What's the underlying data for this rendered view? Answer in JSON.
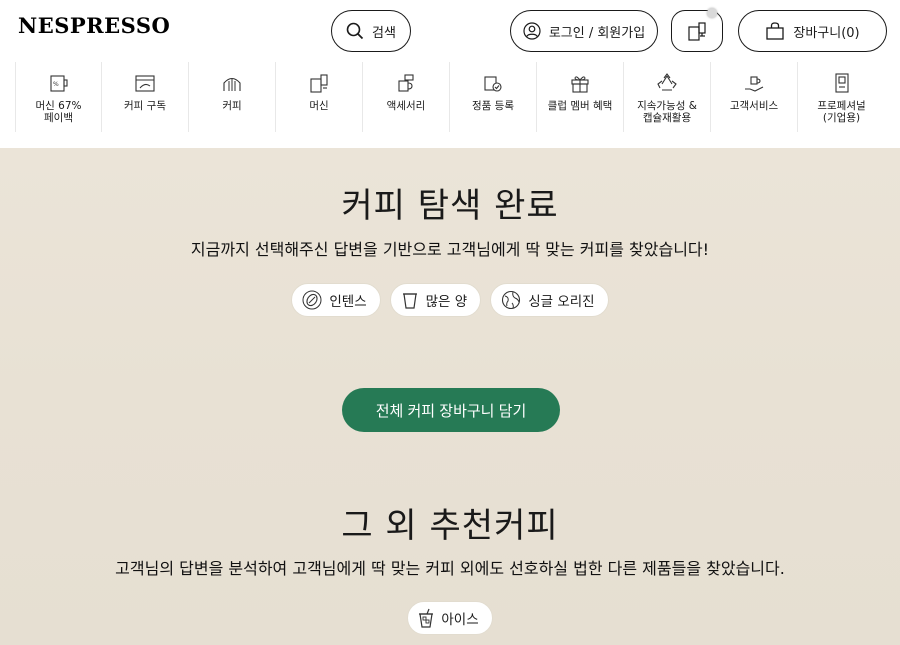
{
  "header": {
    "logo": "NESPRESSO",
    "search_label": "검색",
    "login_label": "로그인 / 회원가입",
    "cart_label": "장바구니(0)"
  },
  "nav": {
    "items": [
      {
        "label": "머신 67%\n페이백",
        "icon": "machine-percent-icon"
      },
      {
        "label": "커피 구독",
        "icon": "calendar-coffee-icon"
      },
      {
        "label": "커피",
        "icon": "coffee-capsule-icon"
      },
      {
        "label": "머신",
        "icon": "coffee-machine-icon"
      },
      {
        "label": "액세서리",
        "icon": "accessories-icon"
      },
      {
        "label": "정품 등록",
        "icon": "register-machine-icon"
      },
      {
        "label": "클럽 멤버 혜택",
        "icon": "gift-icon"
      },
      {
        "label": "지속가능성 &\n캡슐재활용",
        "icon": "recycle-icon"
      },
      {
        "label": "고객서비스",
        "icon": "customer-service-icon"
      },
      {
        "label": "프로페셔널\n(기업용)",
        "icon": "professional-icon"
      }
    ]
  },
  "main": {
    "title": "커피 탐색 완료",
    "subtitle": "지금까지 선택해주신 답변을 기반으로 고객님에게 딱 맞는 커피를 찾았습니다!",
    "tags": [
      {
        "label": "인텐스",
        "icon": "coffee-bean-icon"
      },
      {
        "label": "많은 양",
        "icon": "cup-icon"
      },
      {
        "label": "싱글 오리진",
        "icon": "globe-icon"
      }
    ],
    "cta_label": "전체 커피 장바구니 담기",
    "other_title": "그 외 추천커피",
    "other_subtitle": "고객님의 답변을 분석하여 고객님에게 딱 맞는 커피 외에도 선호하실 법한 다른 제품들을 찾았습니다.",
    "other_tags": [
      {
        "label": "아이스",
        "icon": "iced-drink-icon"
      }
    ]
  },
  "colors": {
    "accent_green": "#267a55",
    "background_beige": "#e8e1d4"
  }
}
